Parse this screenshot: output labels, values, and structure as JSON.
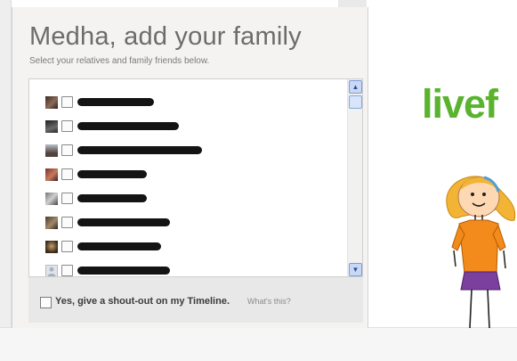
{
  "dialog": {
    "title": "Medha, add your family",
    "subtitle": "Select your relatives and family friends below.",
    "footer": {
      "checkbox_label": "Yes, give a shout-out on my Timeline.",
      "help_link": "What's this?"
    }
  },
  "brand": {
    "logo_text": "livef",
    "logo_color": "#5ab32e"
  },
  "friends": [
    {
      "avatar": "photo",
      "checked": false,
      "name": ""
    },
    {
      "avatar": "photo",
      "checked": false,
      "name": ""
    },
    {
      "avatar": "photo",
      "checked": false,
      "name": ""
    },
    {
      "avatar": "photo",
      "checked": false,
      "name": ""
    },
    {
      "avatar": "photo",
      "checked": false,
      "name": ""
    },
    {
      "avatar": "photo",
      "checked": false,
      "name": ""
    },
    {
      "avatar": "photo",
      "checked": false,
      "name": ""
    },
    {
      "avatar": "default-silhouette",
      "checked": false,
      "name": ""
    }
  ],
  "icons": {
    "scroll_up": "chevron-up-icon",
    "scroll_down": "chevron-down-icon"
  }
}
